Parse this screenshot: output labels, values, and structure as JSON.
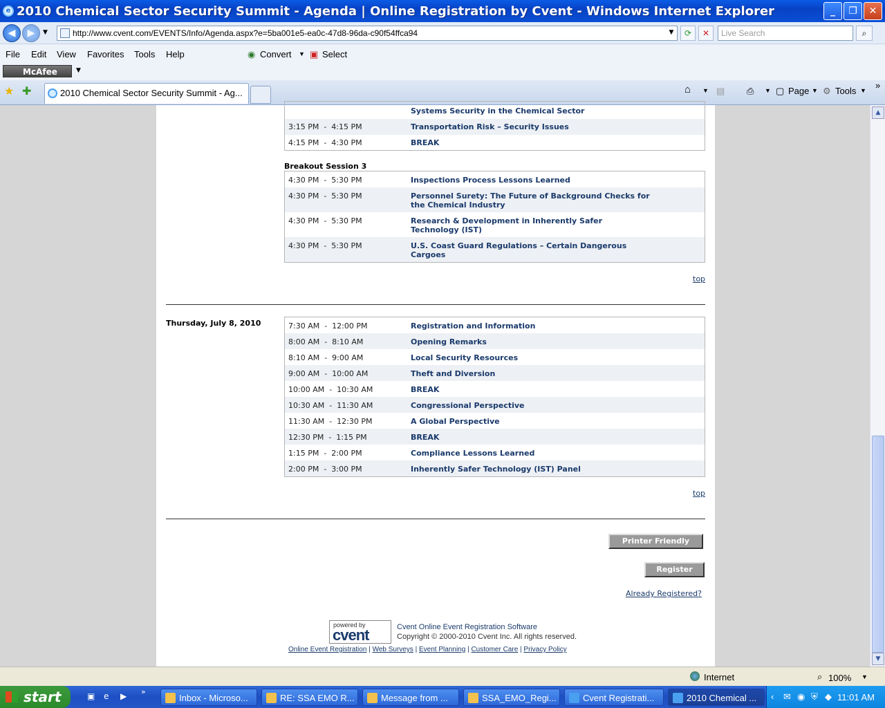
{
  "window": {
    "title": "2010 Chemical Sector Security Summit - Agenda | Online Registration by Cvent - Windows Internet Explorer"
  },
  "address": {
    "url": "http://www.cvent.com/EVENTS/Info/Agenda.aspx?e=5ba001e5-ea0c-47d8-96da-c90f54ffca94",
    "search_placeholder": "Live Search"
  },
  "menu": [
    "File",
    "Edit",
    "View",
    "Favorites",
    "Tools",
    "Help"
  ],
  "toolbar": {
    "convert": "Convert",
    "select": "Select",
    "mcafee": "McAfee",
    "page": "Page",
    "tools": "Tools"
  },
  "tab": {
    "label": "2010 Chemical Sector Security Summit - Ag..."
  },
  "agenda": {
    "top_fragment": "Systems Security in the Chemical Sector",
    "block1": [
      {
        "time": "3:15 PM  -  4:15 PM",
        "title": "Transportation Risk – Security Issues"
      },
      {
        "time": "4:15 PM  -  4:30 PM",
        "title": "BREAK"
      }
    ],
    "breakout_heading": "Breakout Session 3",
    "breakout": [
      {
        "time": "4:30 PM  -  5:30 PM",
        "title": "Inspections Process Lessons Learned"
      },
      {
        "time": "4:30 PM  -  5:30 PM",
        "title": "Personnel Surety: The Future of Background Checks for the Chemical Industry"
      },
      {
        "time": "4:30 PM  -  5:30 PM",
        "title": "Research & Development in Inherently Safer Technology (IST)"
      },
      {
        "time": "4:30 PM  -  5:30 PM",
        "title": "U.S. Coast Guard Regulations – Certain Dangerous Cargoes"
      }
    ],
    "top_link": "top",
    "day": "Thursday, July 8, 2010",
    "day_items": [
      {
        "time": "7:30 AM  -  12:00 PM",
        "title": "Registration and Information"
      },
      {
        "time": "8:00 AM  -  8:10 AM",
        "title": "Opening Remarks"
      },
      {
        "time": "8:10 AM  -  9:00 AM",
        "title": "Local Security Resources"
      },
      {
        "time": "9:00 AM  -  10:00 AM",
        "title": "Theft and Diversion"
      },
      {
        "time": "10:00 AM  -  10:30 AM",
        "title": "BREAK"
      },
      {
        "time": "10:30 AM  -  11:30 AM",
        "title": "Congressional Perspective"
      },
      {
        "time": "11:30 AM  -  12:30 PM",
        "title": "A Global Perspective"
      },
      {
        "time": "12:30 PM  -  1:15 PM",
        "title": "BREAK"
      },
      {
        "time": "1:15 PM  -  2:00 PM",
        "title": "Compliance Lessons Learned"
      },
      {
        "time": "2:00 PM  -  3:00 PM",
        "title": "Inherently Safer Technology (IST) Panel"
      }
    ],
    "printer_friendly": "Printer Friendly",
    "register": "Register",
    "already_registered": "Already Registered?"
  },
  "footer": {
    "powered_by": "powered by",
    "logo": "cvent",
    "line1": "Cvent Online Event Registration Software",
    "line2": "Copyright © 2000-2010 Cvent Inc. All rights reserved.",
    "links": [
      "Online Event Registration",
      "Web Surveys",
      "Event Planning",
      "Customer Care",
      "Privacy Policy"
    ]
  },
  "status": {
    "zone": "Internet",
    "zoom": "100%"
  },
  "taskbar": {
    "start": "start",
    "tasks": [
      "Inbox - Microso...",
      "RE: SSA EMO R...",
      "Message from ...",
      "SSA_EMO_Regi...",
      "Cvent Registrati...",
      "2010 Chemical ..."
    ],
    "clock": "11:01 AM"
  }
}
